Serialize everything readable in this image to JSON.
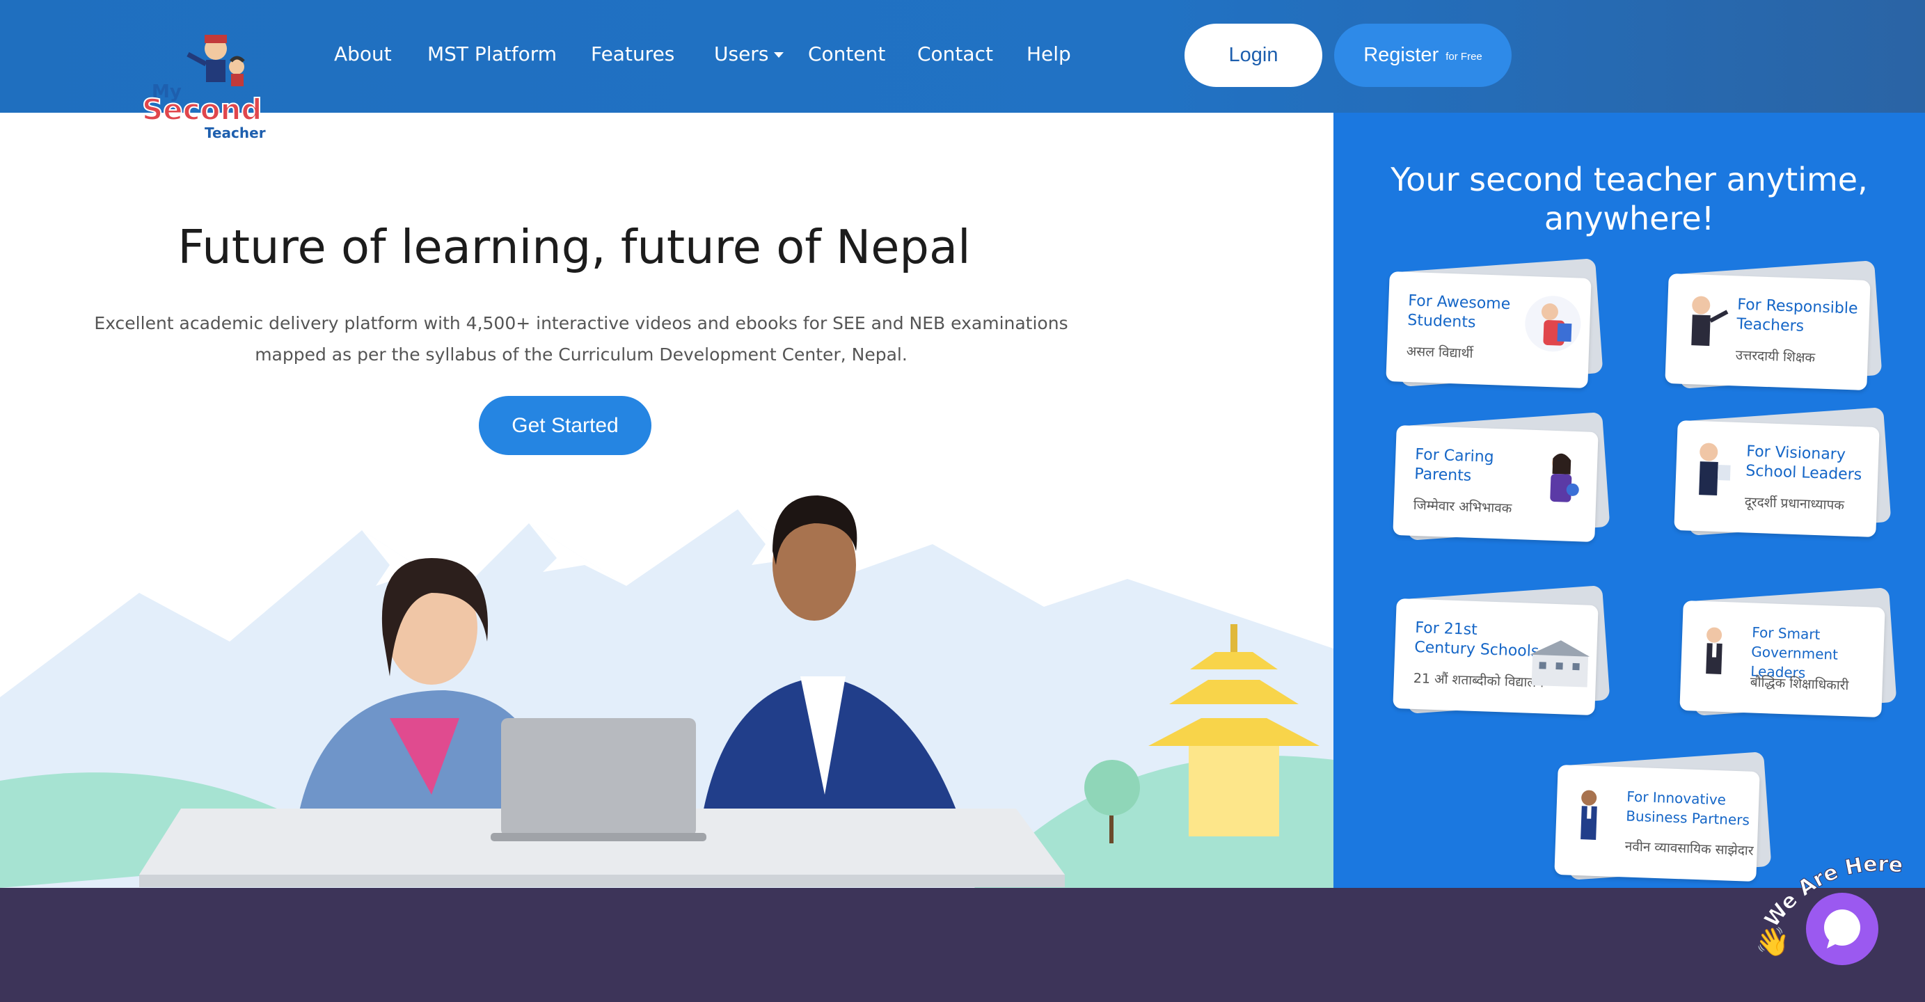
{
  "logo": {
    "line1": "My",
    "line2": "Second",
    "line3": "Teacher"
  },
  "nav": {
    "items": [
      "About",
      "MST Platform",
      "Features",
      "Users",
      "Content",
      "Contact",
      "Help"
    ],
    "login": "Login",
    "register": "Register",
    "register_small": "for Free"
  },
  "hero": {
    "title": "Future of learning, future of Nepal",
    "desc_line1": "Excellent academic delivery platform with 4,500+ interactive videos and ebooks for SEE and NEB examinations",
    "desc_line2": "mapped as per the syllabus of the Curriculum Development Center, Nepal.",
    "cta": "Get Started"
  },
  "panel": {
    "title_line1": "Your second teacher anytime,",
    "title_line2": "anywhere!",
    "cards": [
      {
        "title": "For Awesome Students",
        "nepali": "असल विद्यार्थी"
      },
      {
        "title": "For Responsible Teachers",
        "nepali": "उत्तरदायी शिक्षक"
      },
      {
        "title": "For Caring Parents",
        "nepali": "जिम्मेवार अभिभावक"
      },
      {
        "title": "For Visionary School Leaders",
        "nepali": "दूरदर्शी प्रधानाध्यापक"
      },
      {
        "title": "For 21st Century Schools",
        "nepali": "21 औं शताब्दीको विद्यालय"
      },
      {
        "title": "For Smart Government Leaders",
        "nepali": "बौद्धिक शिक्षाधिकारी"
      },
      {
        "title": "For Innovative Business Partners",
        "nepali": "नवीन व्यावसायिक साझेदार"
      }
    ]
  },
  "chat": {
    "tagline": "We Are Here!"
  },
  "colors": {
    "header": "#1f6fbf",
    "panel": "#1b78e0",
    "cta": "#2585e2",
    "footer": "#3d3459",
    "chat": "#9b59f0"
  }
}
